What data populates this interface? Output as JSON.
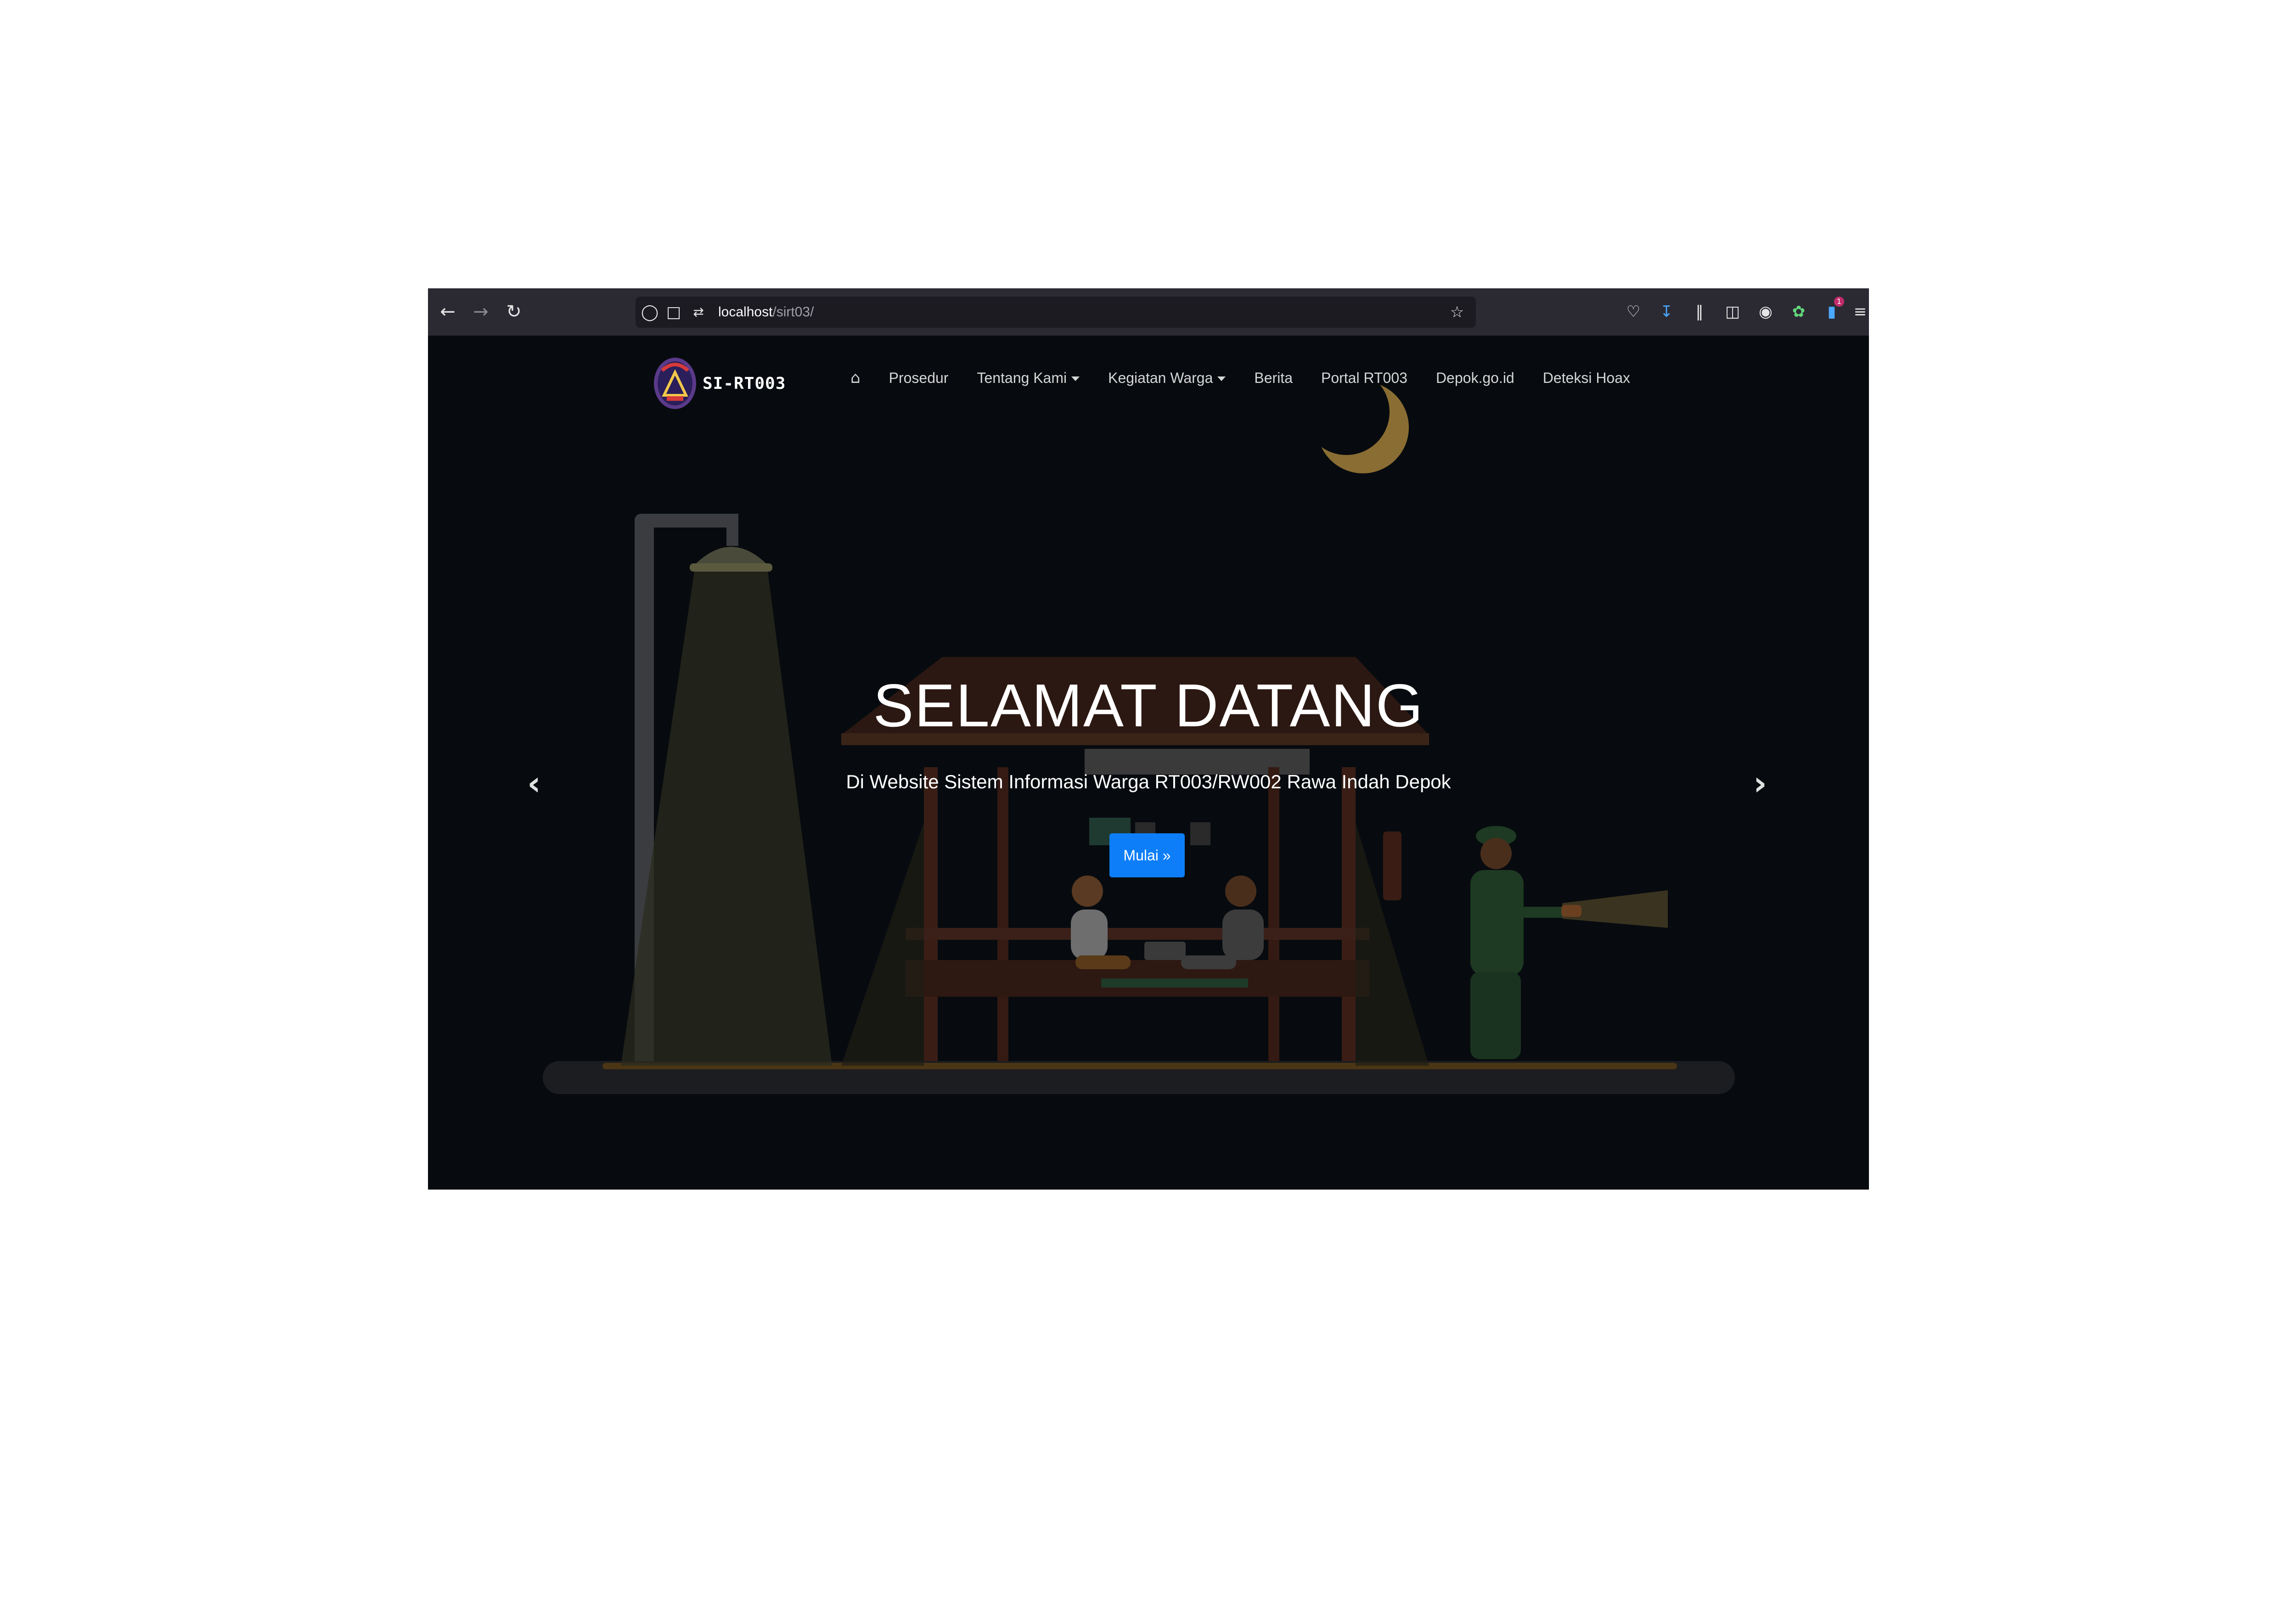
{
  "browser": {
    "url_host": "localhost",
    "url_path": "/sirt03/",
    "toolbar_badge": "1"
  },
  "site": {
    "brand": "SI-RT003",
    "nav": [
      {
        "label": "Prosedur"
      },
      {
        "label": "Tentang Kami"
      },
      {
        "label": "Kegiatan Warga"
      },
      {
        "label": "Berita"
      },
      {
        "label": "Portal RT003"
      },
      {
        "label": "Depok.go.id"
      },
      {
        "label": "Deteksi Hoax"
      }
    ]
  },
  "hero": {
    "title": "SELAMAT DATANG",
    "subtitle": "Di Website Sistem Informasi Warga RT003/RW002 Rawa Indah Depok",
    "button_label": "Mulai",
    "button_icon": "»"
  },
  "colors": {
    "page_bg": "#070b0f",
    "chrome_bg": "#2b2a33",
    "button": "#0d7ef8"
  }
}
